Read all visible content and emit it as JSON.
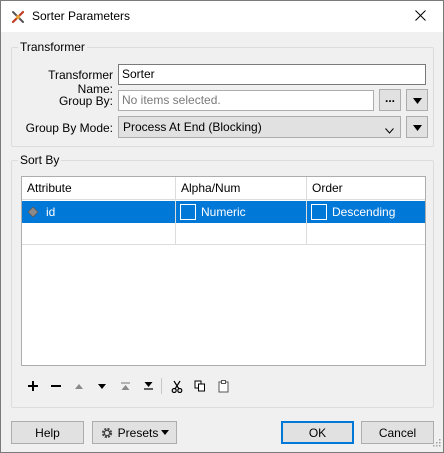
{
  "window": {
    "title": "Sorter Parameters"
  },
  "transformer": {
    "group_label": "Transformer",
    "name_label": "Transformer Name:",
    "name_value": "Sorter",
    "group_by_label": "Group By:",
    "group_by_placeholder": "No items selected.",
    "ellipsis_label": "...",
    "group_by_mode_label": "Group By Mode:",
    "group_by_mode_value": "Process At End (Blocking)"
  },
  "sort_by": {
    "group_label": "Sort By",
    "columns": [
      "Attribute",
      "Alpha/Num",
      "Order"
    ],
    "rows": [
      {
        "attribute": "id",
        "alpha_num": "Numeric",
        "order": "Descending",
        "selected": true
      }
    ]
  },
  "buttons": {
    "help": "Help",
    "presets": "Presets",
    "ok": "OK",
    "cancel": "Cancel"
  },
  "icons": {
    "title": "sorter-transformer-icon",
    "close": "close-icon",
    "toolbar": [
      "add-icon",
      "remove-icon",
      "move-up-icon",
      "move-down-icon",
      "move-to-top-icon",
      "move-to-bottom-icon",
      "cut-icon",
      "copy-icon",
      "paste-icon"
    ]
  },
  "colors": {
    "selection": "#0078d7",
    "default_button_border": "#0078d7"
  }
}
